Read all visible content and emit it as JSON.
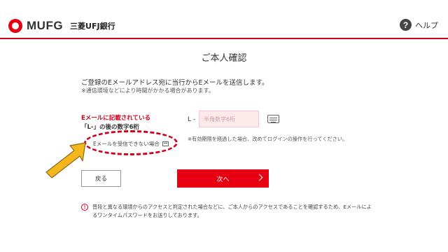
{
  "header": {
    "logo_text": "MUFG",
    "bank_name": "三菱UFJ銀行",
    "help_label": "ヘルプ",
    "help_glyph": "?"
  },
  "page": {
    "title": "ご本人確認",
    "lead": "ご登録のEメールアドレス宛に当行からEメールを送信します。",
    "note": "※通信環境などにより時間がかかる場合があります。"
  },
  "form": {
    "label_line1": "Eメールに記載されている",
    "label_line2": "「L-」の後の数字6桁",
    "prefix": "L -",
    "input_placeholder": "半角数字6桁",
    "input_value": "",
    "expiry_note": "※有効期限を経過した場合、改めてログインの操作を行ってください。",
    "no_email_link": "Eメールを受信できない場合"
  },
  "buttons": {
    "back": "戻る",
    "next": "次へ"
  },
  "alert": {
    "glyph": "!",
    "text": "普段と異なる環境からのアクセスと判定された場合などに、ご本人からのアクセスであることを確認するため、Eメールによるワンタイムパスワードをお送りしております。"
  },
  "colors": {
    "brand_red": "#e60012",
    "annotation_arrow": "#f5b71c",
    "input_bg": "#fde8ea"
  },
  "icons": [
    "help-icon",
    "keyboard-icon",
    "external-window-icon",
    "alert-icon",
    "chevron-right-icon"
  ]
}
